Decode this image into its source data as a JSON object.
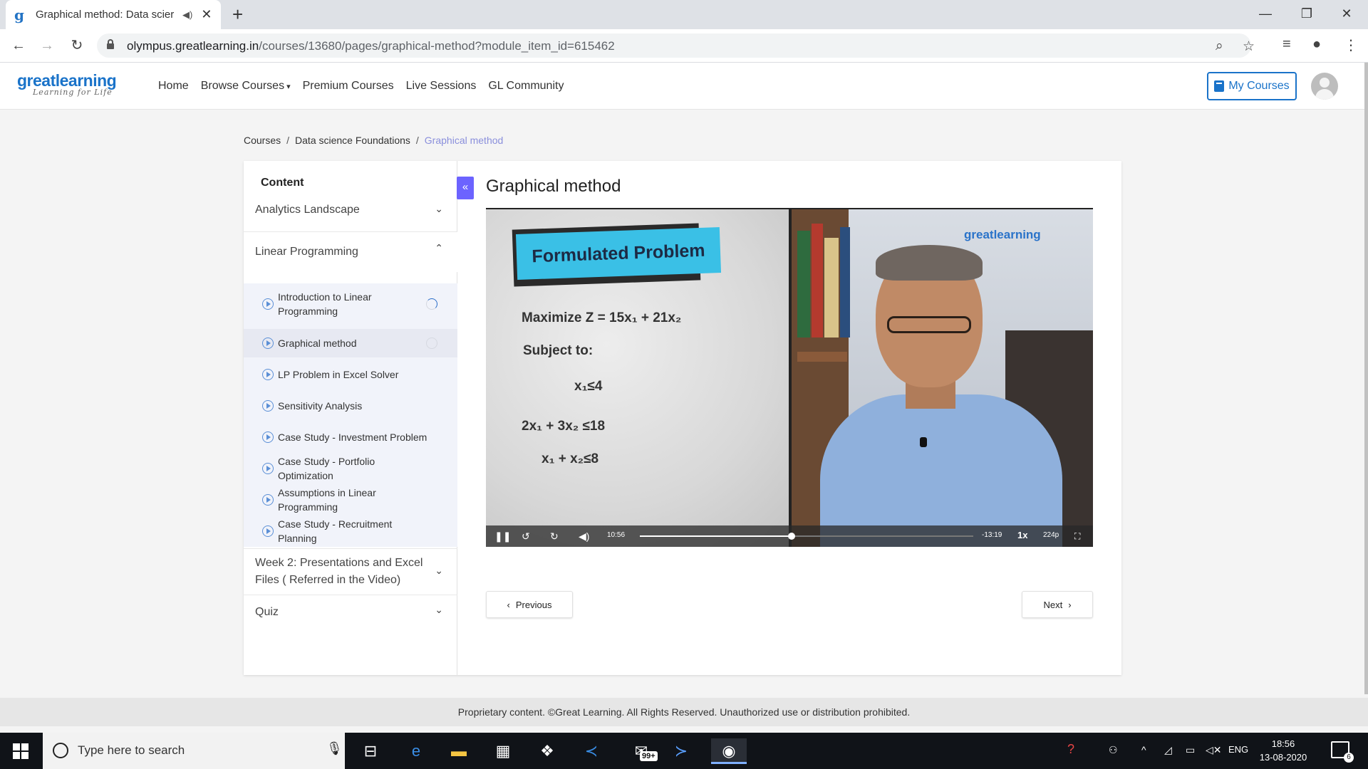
{
  "browser": {
    "tab_title": "Graphical method: Data scier",
    "url_host": "olympus.greatlearning.in",
    "url_path": "/courses/13680/pages/graphical-method?module_item_id=615462"
  },
  "header": {
    "logo_main": "greatlearning",
    "logo_tagline": "Learning for Life",
    "nav": [
      "Home",
      "Browse Courses",
      "Premium Courses",
      "Live Sessions",
      "GL Community"
    ],
    "my_courses": "My Courses"
  },
  "breadcrumb": {
    "items": [
      "Courses",
      "Data science Foundations"
    ],
    "separator": "/",
    "current": "Graphical method"
  },
  "sidebar": {
    "title": "Content",
    "modules": [
      {
        "label": "Analytics Landscape",
        "expanded": false
      },
      {
        "label": "Linear Programming",
        "expanded": true
      },
      {
        "label": "Week 2: Presentations and Excel Files ( Referred in the Video)",
        "expanded": false
      },
      {
        "label": "Quiz",
        "expanded": false
      }
    ],
    "lessons": [
      {
        "label": "Introduction to Linear Programming",
        "progress": "partial"
      },
      {
        "label": "Graphical method",
        "progress": "none",
        "active": true
      },
      {
        "label": "LP Problem in Excel Solver"
      },
      {
        "label": "Sensitivity Analysis"
      },
      {
        "label": "Case Study - Investment Problem"
      },
      {
        "label": "Case Study - Portfolio Optimization"
      },
      {
        "label": "Assumptions in Linear Programming"
      },
      {
        "label": "Case Study - Recruitment Planning"
      }
    ]
  },
  "main": {
    "title": "Graphical method",
    "slide": {
      "banner": "Formulated Problem",
      "objective": "Maximize Z = 15x₁ + 21x₂",
      "subject_to": "Subject to:",
      "constraints": [
        "x₁≤4",
        "2x₁ + 3x₂ ≤18",
        "x₁ + x₂≤8"
      ]
    },
    "video_watermark": "greatlearning",
    "player": {
      "elapsed": "10:56",
      "remaining": "-13:19",
      "speed": "1x",
      "quality": "224p",
      "progress": 0.455
    },
    "prev_label": "Previous",
    "next_label": "Next"
  },
  "footer": {
    "text": "Proprietary content. ©Great Learning. All Rights Reserved. Unauthorized use or distribution prohibited."
  },
  "taskbar": {
    "search_placeholder": "Type here to search",
    "mail_badge": "99+",
    "language": "ENG",
    "time": "18:56",
    "date": "13-08-2020",
    "notifications": "6"
  }
}
